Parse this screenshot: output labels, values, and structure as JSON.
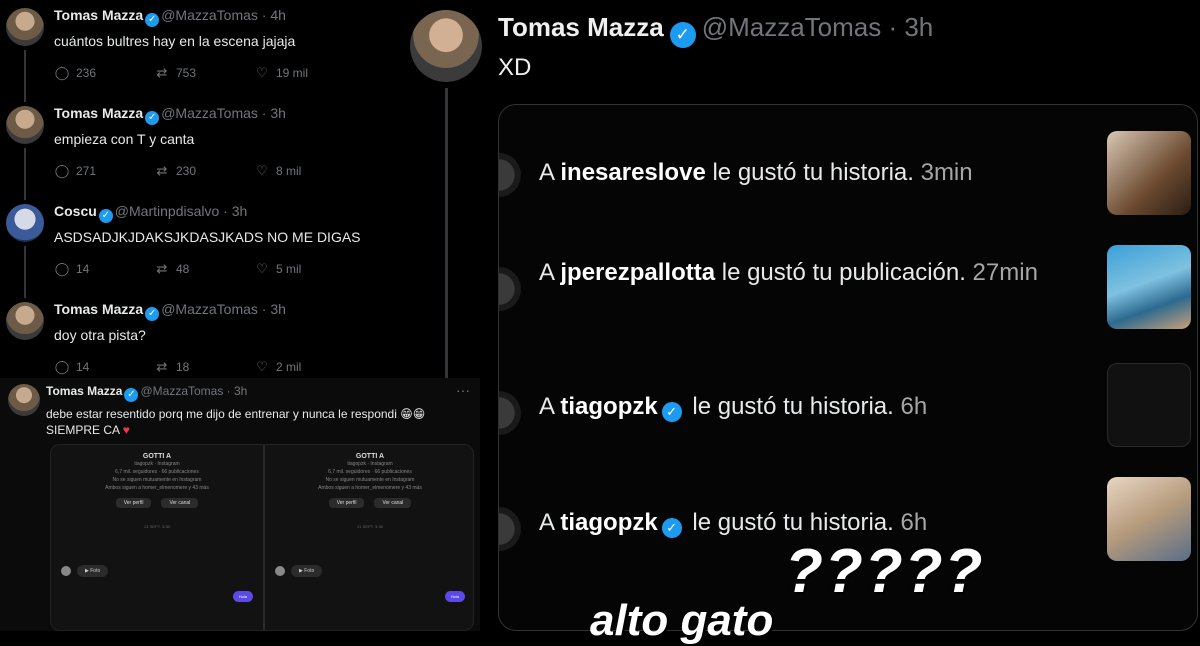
{
  "left_tweets": [
    {
      "name": "Tomas Mazza",
      "handle": "@MazzaTomas · 4h",
      "text": "cuántos bultres hay en la escena jajaja",
      "replies": "236",
      "retweets": "753",
      "likes": "19 mil"
    },
    {
      "name": "Tomas Mazza",
      "handle": "@MazzaTomas · 3h",
      "text": "empieza con T y canta",
      "replies": "271",
      "retweets": "230",
      "likes": "8 mil"
    },
    {
      "name": "Coscu",
      "handle": "@Martinpdisalvo · 3h",
      "text": "ASDSADJKJDAKSJKDASJKADS NO ME DIGAS",
      "replies": "14",
      "retweets": "48",
      "likes": "5 mil"
    },
    {
      "name": "Tomas Mazza",
      "handle": "@MazzaTomas · 3h",
      "text": "doy otra pista?",
      "replies": "14",
      "retweets": "18",
      "likes": "2 mil"
    }
  ],
  "tweet5": {
    "name": "Tomas Mazza",
    "handle": "@MazzaTomas · 3h",
    "more": "···",
    "line1": "debe estar resentido porq me dijo de entrenar y nunca le respondi 😁😁",
    "line2": "SIEMPRE CA",
    "heart": "♥"
  },
  "mini": {
    "title": "GOTTI A",
    "sub1": "tiagopzk · Instagram",
    "sub2": "6,7 mil. seguidores · 66 publicaciones",
    "sub3": "No se siguen mutuamente en Instagram",
    "sub4": "Ambos siguen a homer_elmenomere y 43 más",
    "btn1": "Ver perfil",
    "btn2": "Ver canal",
    "date": "21 SEPT. 3:38",
    "bubble": "▶ Foto",
    "blue": "Hola"
  },
  "main_tweet": {
    "name": "Tomas Mazza",
    "handle": "@MazzaTomas · 3h",
    "text": "XD"
  },
  "notifications": [
    {
      "prefix": "A ",
      "user": "inesareslove",
      "rest": " le gustó tu historia.",
      "time": " 3min",
      "verified": false
    },
    {
      "prefix": "A ",
      "user": "jperezpallotta",
      "rest": " le gustó tu publicación.",
      "time": " 27min",
      "verified": false
    },
    {
      "prefix": "A ",
      "user": "tiagopzk",
      "rest": " le gustó tu historia.",
      "time": " 6h",
      "verified": true
    },
    {
      "prefix": "A ",
      "user": "tiagopzk",
      "rest": " le gustó tu historia.",
      "time": " 6h",
      "verified": true
    }
  ],
  "overlay": {
    "qmarks": "?????",
    "caption": "alto gato"
  },
  "icons": {
    "reply": "reply-icon",
    "retweet": "retweet-icon",
    "like": "like-icon",
    "verified": "verified-badge-icon"
  },
  "colors": {
    "verified": "#1d9bf0",
    "heart": "#f2364f",
    "muted": "#71767b"
  }
}
